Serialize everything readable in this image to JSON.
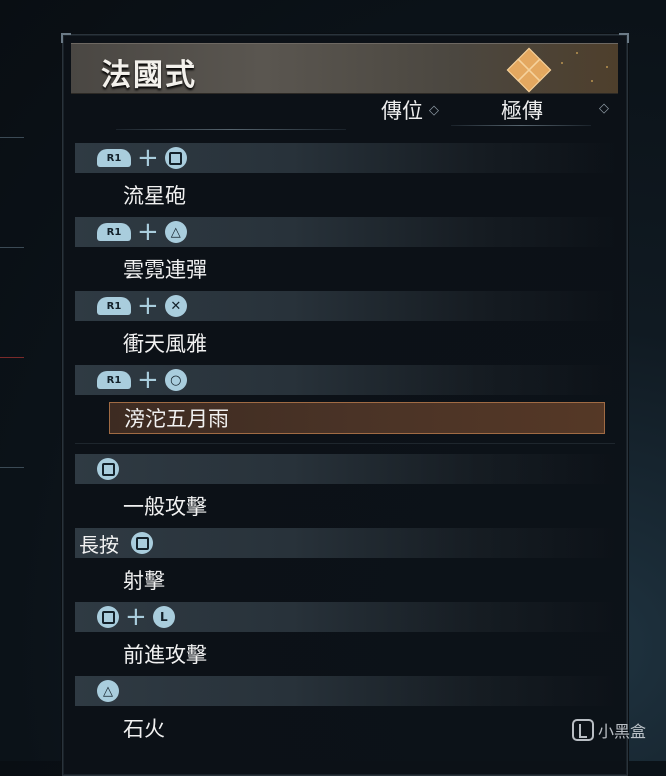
{
  "panel": {
    "title": "法國式",
    "tabs": [
      {
        "label": "傳位",
        "active": true
      },
      {
        "label": "極傳",
        "active": false
      }
    ]
  },
  "moves": [
    {
      "inputs": [
        "R1",
        "+",
        "square"
      ],
      "name": "流星砲"
    },
    {
      "inputs": [
        "R1",
        "+",
        "triangle"
      ],
      "name": "雲霓連彈"
    },
    {
      "inputs": [
        "R1",
        "+",
        "cross"
      ],
      "name": "衝天風雅"
    },
    {
      "inputs": [
        "R1",
        "+",
        "circle"
      ],
      "name": "滂沱五月雨",
      "selected": true
    },
    {
      "inputs": [
        "square"
      ],
      "name": "一般攻擊"
    },
    {
      "prefix": "長按",
      "inputs": [
        "square"
      ],
      "name": "射擊"
    },
    {
      "inputs": [
        "square",
        "+",
        "L-stick"
      ],
      "name": "前進攻擊"
    },
    {
      "inputs": [
        "triangle"
      ],
      "name": "石火"
    }
  ],
  "button_glyphs": {
    "R1": "R1",
    "triangle": "△",
    "cross": "✕",
    "circle": "○",
    "L": "L"
  },
  "watermark": "小黑盒",
  "colors": {
    "button": "#a9cddd",
    "accent": "#e4a860",
    "selected_border": "#a06b44"
  }
}
